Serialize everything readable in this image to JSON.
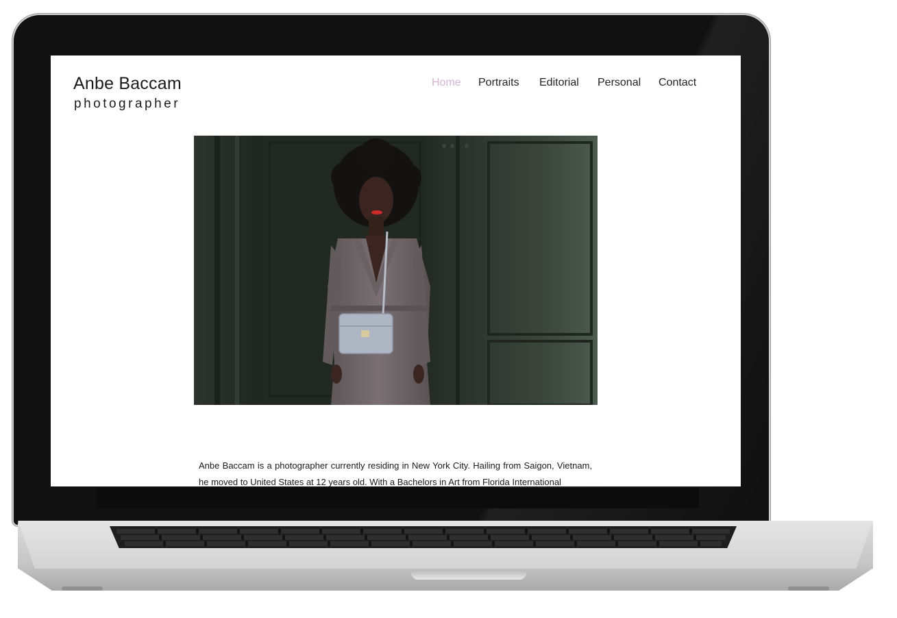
{
  "site": {
    "name": "Anbe Baccam",
    "tagline": "photographer"
  },
  "nav": {
    "items": [
      {
        "label": "Home",
        "active": true
      },
      {
        "label": "Portraits",
        "active": false
      },
      {
        "label": "Editorial",
        "active": false
      },
      {
        "label": "Personal",
        "active": false
      },
      {
        "label": "Contact",
        "active": false
      }
    ]
  },
  "colors": {
    "active_nav": "#d3b5d2",
    "text": "#1a1a1a",
    "door_green": "#2a312a",
    "coat_taupe": "#6f6669"
  },
  "bio": {
    "text": "Anbe Baccam is a photographer currently residing in New York City. Hailing from Saigon, Vietnam, he moved to United States at 12 years old. With a Bachelors in Art from Florida International"
  }
}
